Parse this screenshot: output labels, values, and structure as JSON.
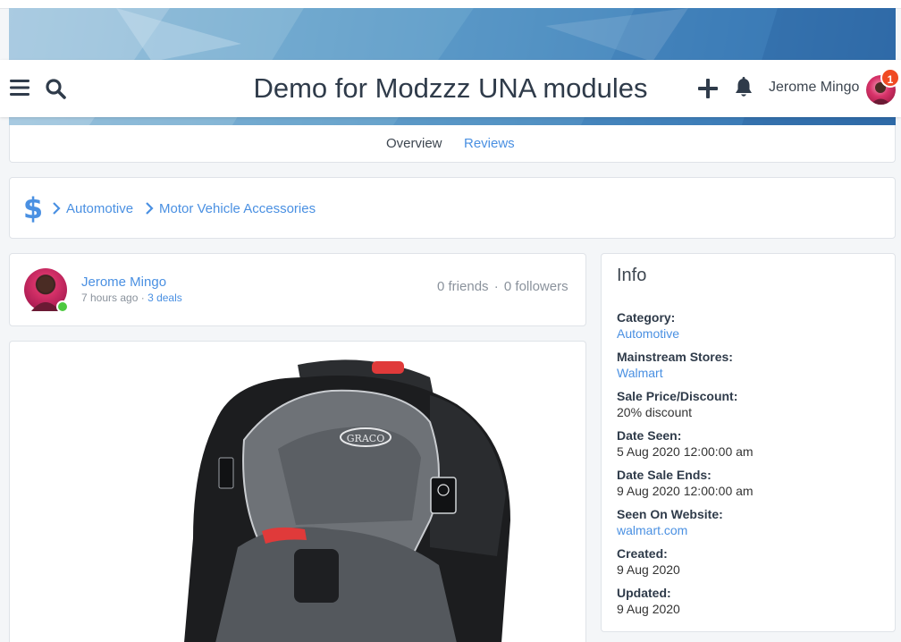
{
  "colors": {
    "accent": "#4a90e2",
    "title": "#2f3b4a",
    "notification_badge": "#f04a23",
    "online": "#4cc93f"
  },
  "header": {
    "menu_icon": "hamburger-menu-icon",
    "search_icon": "search-icon",
    "site_title": "Demo for Modzzz UNA modules",
    "add_icon": "plus-icon",
    "notifications_icon": "bell-icon",
    "notification_count": "1",
    "user_name": "Jerome Mingo"
  },
  "tabs": [
    {
      "label": "Overview",
      "active": false
    },
    {
      "label": "Reviews",
      "active": true
    }
  ],
  "breadcrumb": {
    "root_icon": "dollar-sign-icon",
    "separator_icon": "chevron-right-icon",
    "items": [
      "Automotive",
      "Motor Vehicle Accessories"
    ]
  },
  "author": {
    "name": "Jerome Mingo",
    "time": "7 hours ago",
    "separator": "·",
    "deals": "3 deals",
    "friends": "0 friends",
    "followers": "0 followers",
    "online": true
  },
  "product_image": {
    "brand_text": "GRACO",
    "icon": "car-seat-image"
  },
  "info": {
    "title": "Info",
    "fields": [
      {
        "label": "Category:",
        "value": "Automotive",
        "link": true
      },
      {
        "label": "Mainstream Stores:",
        "value": "Walmart",
        "link": true
      },
      {
        "label": "Sale Price/Discount:",
        "value": "20% discount",
        "link": false
      },
      {
        "label": "Date Seen:",
        "value": "5 Aug 2020 12:00:00 am",
        "link": false
      },
      {
        "label": "Date Sale Ends:",
        "value": "9 Aug 2020 12:00:00 am",
        "link": false
      },
      {
        "label": "Seen On Website:",
        "value": "walmart.com",
        "link": true
      },
      {
        "label": "Created:",
        "value": "9 Aug 2020",
        "link": false
      },
      {
        "label": "Updated:",
        "value": "9 Aug 2020",
        "link": false
      }
    ]
  }
}
